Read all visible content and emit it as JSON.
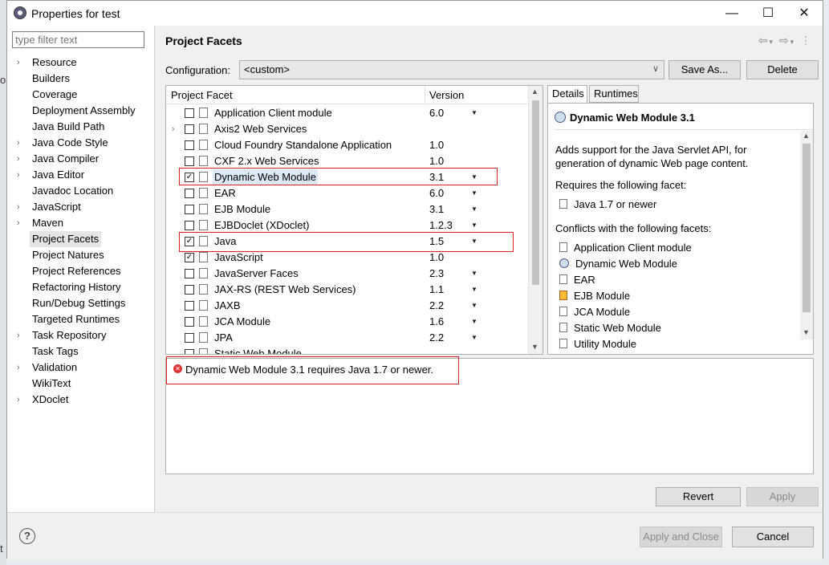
{
  "window": {
    "title": "Properties for test",
    "controls": [
      "—",
      "☐",
      "✕"
    ]
  },
  "background_fragments": [
    "or",
    "t"
  ],
  "filter": {
    "placeholder": "type filter text"
  },
  "tree": [
    {
      "label": "Resource",
      "expandable": true
    },
    {
      "label": "Builders",
      "expandable": false
    },
    {
      "label": "Coverage",
      "expandable": false
    },
    {
      "label": "Deployment Assembly",
      "expandable": false
    },
    {
      "label": "Java Build Path",
      "expandable": false
    },
    {
      "label": "Java Code Style",
      "expandable": true
    },
    {
      "label": "Java Compiler",
      "expandable": true
    },
    {
      "label": "Java Editor",
      "expandable": true
    },
    {
      "label": "Javadoc Location",
      "expandable": false
    },
    {
      "label": "JavaScript",
      "expandable": true
    },
    {
      "label": "Maven",
      "expandable": true
    },
    {
      "label": "Project Facets",
      "expandable": false,
      "selected": true
    },
    {
      "label": "Project Natures",
      "expandable": false
    },
    {
      "label": "Project References",
      "expandable": false
    },
    {
      "label": "Refactoring History",
      "expandable": false
    },
    {
      "label": "Run/Debug Settings",
      "expandable": false
    },
    {
      "label": "Targeted Runtimes",
      "expandable": false
    },
    {
      "label": "Task Repository",
      "expandable": true
    },
    {
      "label": "Task Tags",
      "expandable": false
    },
    {
      "label": "Validation",
      "expandable": true
    },
    {
      "label": "WikiText",
      "expandable": false
    },
    {
      "label": "XDoclet",
      "expandable": true
    }
  ],
  "page": {
    "title": "Project Facets",
    "nav_icons": [
      "back-arrow-icon",
      "dropdown-icon",
      "forward-arrow-icon",
      "dropdown-icon",
      "view-menu-icon"
    ]
  },
  "configuration": {
    "label": "Configuration:",
    "value": "<custom>",
    "save_as": "Save As...",
    "delete": "Delete"
  },
  "facets_table": {
    "col_facet": "Project Facet",
    "col_version": "Version",
    "rows": [
      {
        "name": "Application Client module",
        "version": "6.0",
        "checked": false,
        "dropdown": true,
        "expandable": false
      },
      {
        "name": "Axis2 Web Services",
        "version": "",
        "checked": false,
        "dropdown": false,
        "expandable": true
      },
      {
        "name": "Cloud Foundry Standalone Application",
        "version": "1.0",
        "checked": false,
        "dropdown": false,
        "expandable": false
      },
      {
        "name": "CXF 2.x Web Services",
        "version": "1.0",
        "checked": false,
        "dropdown": false,
        "expandable": false
      },
      {
        "name": "Dynamic Web Module",
        "version": "3.1",
        "checked": true,
        "dropdown": true,
        "expandable": false,
        "highlight": true
      },
      {
        "name": "EAR",
        "version": "6.0",
        "checked": false,
        "dropdown": true,
        "expandable": false
      },
      {
        "name": "EJB Module",
        "version": "3.1",
        "checked": false,
        "dropdown": true,
        "expandable": false
      },
      {
        "name": "EJBDoclet (XDoclet)",
        "version": "1.2.3",
        "checked": false,
        "dropdown": true,
        "expandable": false
      },
      {
        "name": "Java",
        "version": "1.5",
        "checked": true,
        "dropdown": true,
        "expandable": false
      },
      {
        "name": "JavaScript",
        "version": "1.0",
        "checked": true,
        "dropdown": false,
        "expandable": false
      },
      {
        "name": "JavaServer Faces",
        "version": "2.3",
        "checked": false,
        "dropdown": true,
        "expandable": false
      },
      {
        "name": "JAX-RS (REST Web Services)",
        "version": "1.1",
        "checked": false,
        "dropdown": true,
        "expandable": false
      },
      {
        "name": "JAXB",
        "version": "2.2",
        "checked": false,
        "dropdown": true,
        "expandable": false
      },
      {
        "name": "JCA Module",
        "version": "1.6",
        "checked": false,
        "dropdown": true,
        "expandable": false
      },
      {
        "name": "JPA",
        "version": "2.2",
        "checked": false,
        "dropdown": true,
        "expandable": false
      },
      {
        "name": "Static Web Module",
        "version": "",
        "checked": false,
        "dropdown": false,
        "expandable": false
      }
    ]
  },
  "details": {
    "tab_details": "Details",
    "tab_runtimes": "Runtimes",
    "title": "Dynamic Web Module 3.1",
    "description_line1": "Adds support for the Java Servlet API, for",
    "description_line2": "generation of dynamic Web page content.",
    "requires_label": "Requires the following facet:",
    "requires": [
      "Java 1.7 or newer"
    ],
    "conflicts_label": "Conflicts with the following facets:",
    "conflicts": [
      "Application Client module",
      "Dynamic Web Module",
      "EAR",
      "EJB Module",
      "JCA Module",
      "Static Web Module",
      "Utility Module"
    ]
  },
  "message": {
    "text": "Dynamic Web Module 3.1 requires Java 1.7 or newer."
  },
  "buttons": {
    "revert": "Revert",
    "apply": "Apply",
    "apply_close": "Apply and Close",
    "cancel": "Cancel",
    "help": "?"
  }
}
